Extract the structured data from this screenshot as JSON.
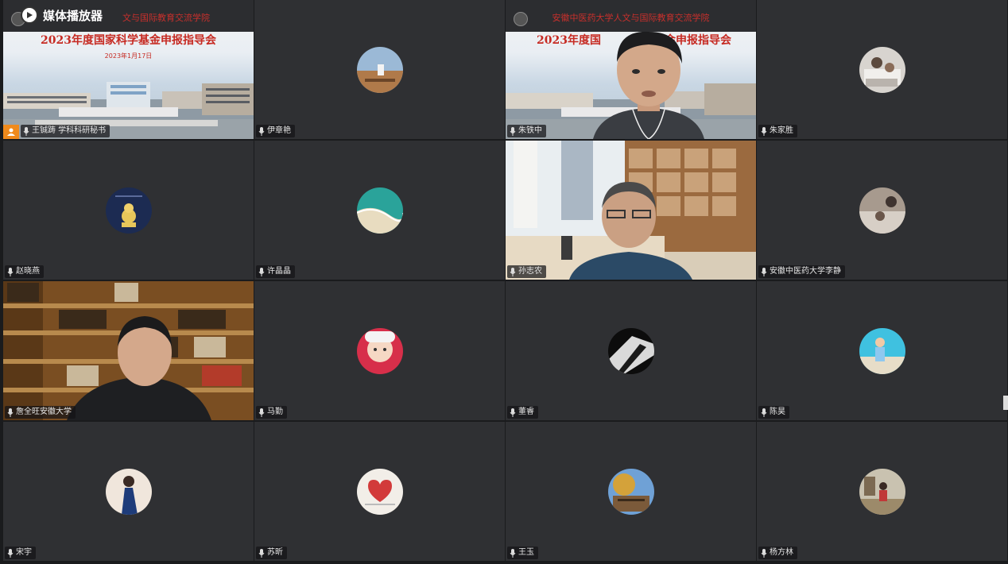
{
  "player": {
    "title": "媒体播放器"
  },
  "slide": {
    "institution": "安徽中医药大学人文与国际教育交流学院",
    "institution_partial": "文与国际教育交流学院",
    "title": "2023年度国家科学基金申报指导会",
    "title_partial_left": "2023年度国",
    "title_partial_right": "金申报指导会",
    "date": "2023年1月17日"
  },
  "participants": [
    {
      "name": "王铖踌 学科科研秘书",
      "type": "screen-share",
      "host": true,
      "avatar": "presentation"
    },
    {
      "name": "伊章艳",
      "type": "avatar",
      "avatar": "person-on-bench"
    },
    {
      "name": "朱铁中",
      "type": "video",
      "avatar": "man-glasses-off"
    },
    {
      "name": "朱家胜",
      "type": "avatar",
      "avatar": "family-photo"
    },
    {
      "name": "赵晓燕",
      "type": "avatar",
      "avatar": "cartoon-bear"
    },
    {
      "name": "许晶晶",
      "type": "avatar",
      "avatar": "sea-shore"
    },
    {
      "name": "孙志农",
      "type": "video",
      "avatar": "man-in-study"
    },
    {
      "name": "安徽中医药大学李静",
      "type": "avatar",
      "avatar": "mother-child"
    },
    {
      "name": "詹全旺安徽大学",
      "type": "video",
      "avatar": "man-bookshelf"
    },
    {
      "name": "马勤",
      "type": "avatar",
      "avatar": "baby"
    },
    {
      "name": "董睿",
      "type": "avatar",
      "avatar": "black-white-abstract"
    },
    {
      "name": "陈昊",
      "type": "avatar",
      "avatar": "child-on-beach"
    },
    {
      "name": "宋宇",
      "type": "avatar",
      "avatar": "woman-blue-dress"
    },
    {
      "name": "苏昕",
      "type": "avatar",
      "avatar": "heart-card"
    },
    {
      "name": "王玉",
      "type": "avatar",
      "avatar": "building-tree"
    },
    {
      "name": "杨方林",
      "type": "avatar",
      "avatar": "child-outdoors"
    }
  ],
  "colors": {
    "tile_bg": "#2f3033",
    "host_badge": "#f08a1c",
    "slide_red": "#c62a22"
  }
}
